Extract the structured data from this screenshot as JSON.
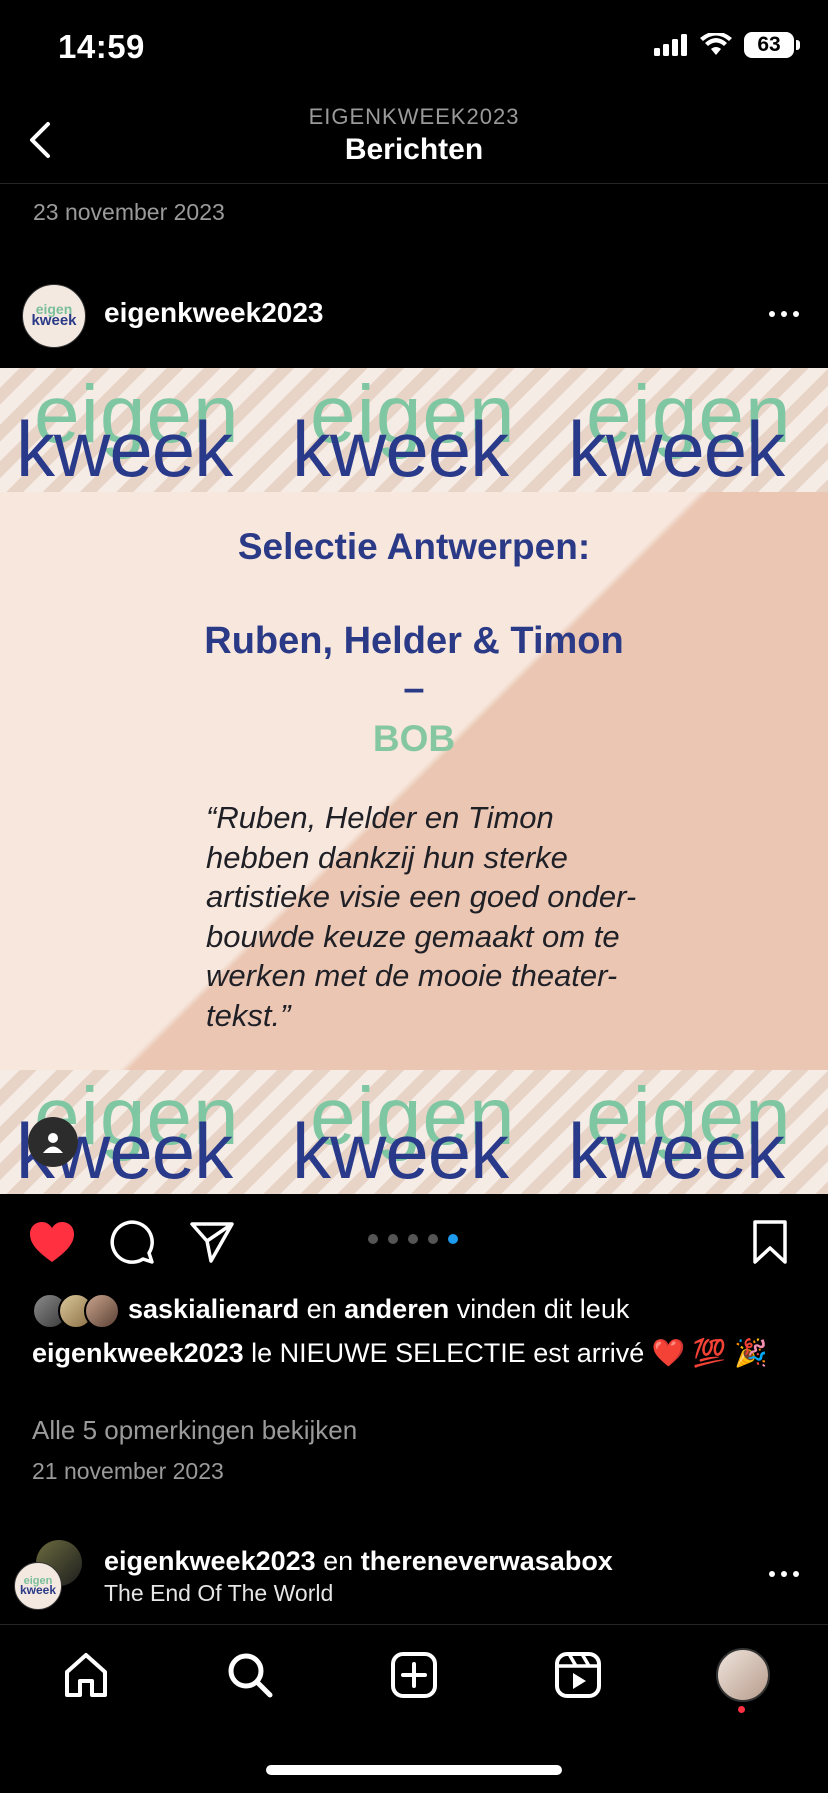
{
  "status_bar": {
    "time": "14:59",
    "battery": "63",
    "icons": [
      "signal-icon",
      "wifi-icon",
      "battery-icon"
    ]
  },
  "header": {
    "subtitle": "EIGENKWEEK2023",
    "title": "Berichten"
  },
  "date_top": "23 november 2023",
  "post": {
    "username": "eigenkweek2023",
    "avatar_text": {
      "line1": "eigen",
      "line2": "kweek"
    },
    "image": {
      "logo_eigen": "eigen",
      "logo_kweek": "kweek",
      "heading": "Selectie Antwerpen:",
      "names": "Ruben, Helder & Timon",
      "dash": "–",
      "production": "BOB",
      "quote_lines": [
        "“Ruben, Helder en Timon",
        "hebben dankzij hun sterke",
        "artistieke visie een goed onder-",
        "bouwde keuze gemaakt om te",
        "werken met de mooie theater-",
        "tekst.”"
      ]
    },
    "carousel": {
      "count": 5,
      "active": 4
    },
    "likes": {
      "user": "saskialienard",
      "connector": " en ",
      "others": "anderen",
      "suffix": " vinden dit leuk"
    },
    "caption": {
      "user": "eigenkweek2023",
      "text": " le NIEUWE SELECTIE est arrivé ❤️ 💯 🎉"
    },
    "view_comments": "Alle 5 opmerkingen bekijken",
    "date": "21 november 2023"
  },
  "next_post": {
    "user1": "eigenkweek2023",
    "connector": " en ",
    "user2": "thereneverwasabox",
    "subtitle": "The End Of The World"
  },
  "colors": {
    "accent_blue": "#1d9bf0",
    "like_red": "#ff3040",
    "kweek_blue": "#2a3a86",
    "eigen_green": "#7fc6a2"
  }
}
